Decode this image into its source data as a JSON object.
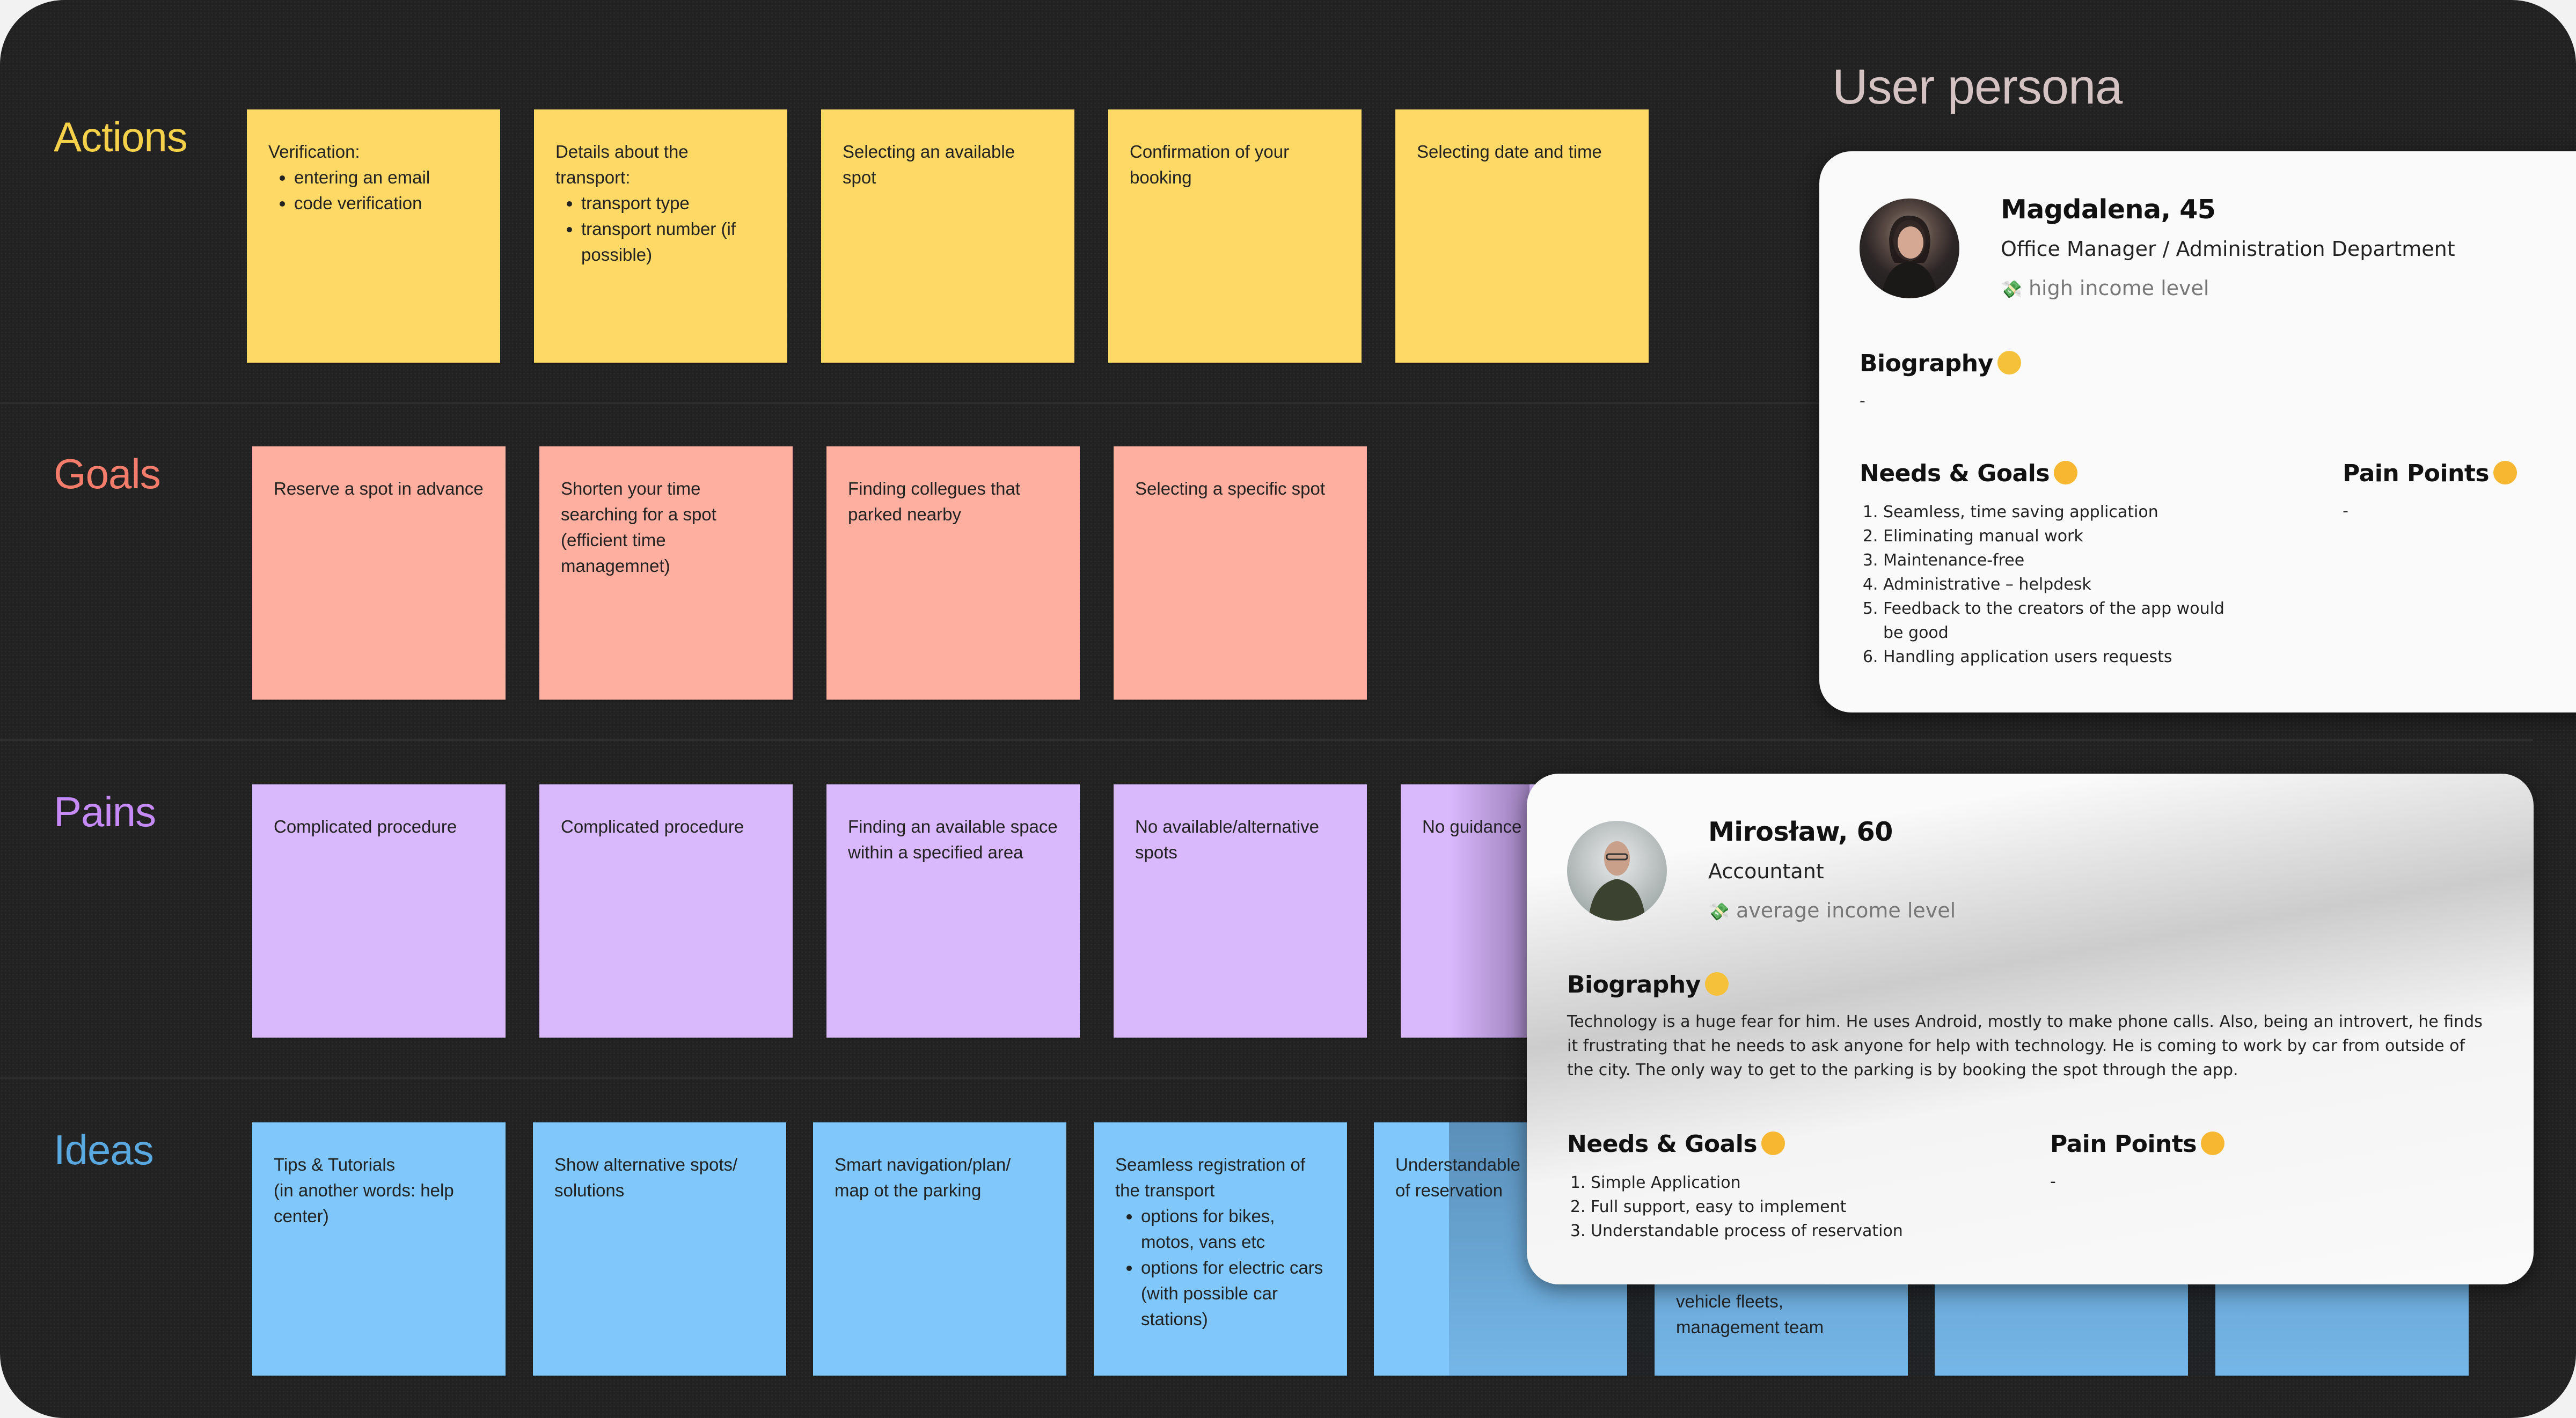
{
  "rows": [
    {
      "label": "Actions",
      "color": "#f6d14a",
      "notes": [
        {
          "title": "Verification:",
          "bullets": [
            "entering an email",
            "code verification"
          ]
        },
        {
          "title": "Details about the transport:",
          "bullets": [
            "transport type",
            "transport number (if possible)"
          ]
        },
        {
          "title": "Selecting an available spot",
          "bullets": []
        },
        {
          "title": "Confirmation of your booking",
          "bullets": []
        },
        {
          "title": "Selecting date and time",
          "bullets": []
        }
      ]
    },
    {
      "label": "Goals",
      "color": "#f47c6b",
      "notes": [
        {
          "title": "Reserve a spot in advance",
          "bullets": []
        },
        {
          "title": "Shorten your time searching for a spot (efficient time managemnet)",
          "bullets": []
        },
        {
          "title": "Finding collegues that parked nearby",
          "bullets": []
        },
        {
          "title": "Selecting a specific spot",
          "bullets": []
        }
      ]
    },
    {
      "label": "Pains",
      "color": "#c58af5",
      "notes": [
        {
          "title": "Complicated procedure",
          "bullets": []
        },
        {
          "title": "Complicated procedure",
          "bullets": []
        },
        {
          "title": "Finding an available space within a specified area",
          "bullets": []
        },
        {
          "title": "No available/alternative spots",
          "bullets": []
        },
        {
          "title": "No guidance",
          "bullets": []
        }
      ]
    },
    {
      "label": "Ideas",
      "color": "#5aa8e0",
      "notes": [
        {
          "title": "Tips &  Tutorials\n(in another words: help center)",
          "bullets": []
        },
        {
          "title": "Show alternative spots/ solutions",
          "bullets": []
        },
        {
          "title": "Smart navigation/plan/ map ot the parking",
          "bullets": []
        },
        {
          "title": "Seamless registration of the transport",
          "bullets": [
            "options for bikes, motos, vans etc",
            "options for electric cars (with possible car stations)"
          ]
        },
        {
          "title": "Understandable of reservation",
          "bullets": []
        },
        {
          "title": "vehicle fleets, management team",
          "bullets": []
        },
        {
          "title": "",
          "bullets": []
        },
        {
          "title": "",
          "bullets": []
        }
      ]
    }
  ],
  "persona_section": {
    "title": "User persona",
    "personas": [
      {
        "name": "Magdalena, 45",
        "role": "Office Manager / Administration Department",
        "income_icon": "💸",
        "income": "high income level",
        "biography_heading": "Biography",
        "biography_emoji": "👱‍♀️",
        "biography": "-",
        "needs_heading": "Needs & Goals",
        "needs_emoji": "😍",
        "needs": [
          "Seamless, time saving application",
          "Eliminating manual work",
          "Maintenance-free",
          "Administrative – helpdesk",
          "Feedback to the creators of the app would be good",
          "Handling application users requests"
        ],
        "pain_heading": "Pain Points",
        "pain_emoji": "😖",
        "pain_points": "-"
      },
      {
        "name": "Mirosław, 60",
        "role": "Accountant",
        "income_icon": "💸",
        "income": "average income level",
        "biography_heading": "Biography",
        "biography_emoji": "👱‍♀️",
        "biography": "Technology is a huge fear for him. He uses Android, mostly to make phone calls. Also, being an introvert, he finds it frustrating that he needs to ask anyone for help with technology. He is coming to work by car from outside of the city. The only way to get to the parking is by booking the spot through the app.",
        "needs_heading": "Needs & Goals",
        "needs_emoji": "😍",
        "needs": [
          "Simple Application",
          "Full support, easy to implement",
          "Understandable process of reservation"
        ],
        "pain_heading": "Pain Points",
        "pain_emoji": "😖",
        "pain_points": "-"
      }
    ]
  }
}
